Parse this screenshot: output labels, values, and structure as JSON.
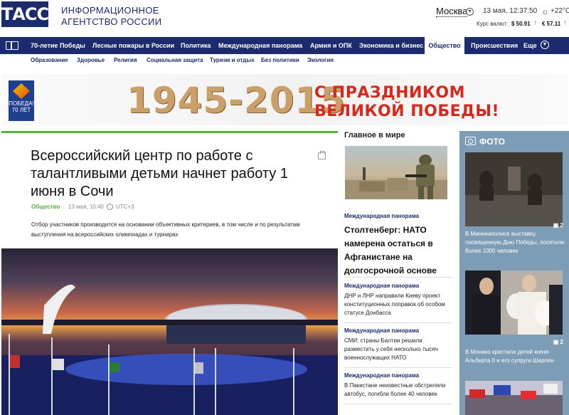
{
  "header": {
    "logo": "ТАСС",
    "agency_line1": "ИНФОРМАЦИОННОЕ",
    "agency_line2": "АГЕНТСТВО РОССИИ",
    "city": "Москва",
    "datetime": "13 мая, 12:37:50",
    "temperature": "+22°C",
    "rates_label": "Курс валют:",
    "usd": "$ 50.91",
    "eur": "€ 57.11"
  },
  "nav": {
    "items": [
      "70-летие Победы",
      "Лесные пожары в России",
      "Политика",
      "Международная панорама",
      "Армия и ОПК",
      "Экономика и бизнес",
      "Общество",
      "Происшествия",
      "Еще"
    ],
    "active": "Общество"
  },
  "subnav": [
    "Образование",
    "Здоровье",
    "Религия",
    "Социальная защита",
    "Туризм и отдых",
    "Без политики",
    "Экология"
  ],
  "banner": {
    "badge_line1": "ПОБЕДА!",
    "badge_line2": "70 ЛЕТ",
    "years": "1945-2015",
    "line1": "С ПРАЗДНИКОМ",
    "line2": "ВЕЛИКОЙ ПОБЕДЫ!"
  },
  "article": {
    "title": "Всероссийский центр по работе с талантливыми детьми начнет работу 1 июня в Сочи",
    "category": "Общество",
    "date": "13 мая, 10:40",
    "timezone": "UTC+3",
    "lead": "Отбор участников производится на основании объективных критериев, в том числе и по результатам выступления на всероссийских олимпиадах и турнирах"
  },
  "world": {
    "title": "Главное в мире",
    "main_tag": "Международная панорама",
    "main_headline": "Столтенберг: НАТО намерена остаться в Афганистане на долгосрочной основе",
    "items": [
      {
        "tag": "Международная панорама",
        "text": "ДНР и ЛНР направили Киеву проект конституционных поправок об особом статусе Донбасса"
      },
      {
        "tag": "Международная панорама",
        "text": "СМИ: страны Балтии решили разместить у себя несколько тысяч военнослужащих НАТО"
      },
      {
        "tag": "Международная панорама",
        "text": "В Пакистане неизвестные обстреляли автобус, погибли более 40 человек"
      }
    ]
  },
  "photo": {
    "title": "ФОТО",
    "items": [
      {
        "count": "2",
        "caption": "В Миннеаполисе выставку, посвященную Дню Победы, посетили более 1000 человек"
      },
      {
        "count": "2",
        "caption": "В Монако крестили детей князя Альберта II и его супруги Шарлен"
      },
      {
        "count": "",
        "caption": ""
      }
    ]
  },
  "colors": {
    "brand": "#1c2b6e",
    "accent_green": "#5ab239",
    "banner_red": "#d8281b",
    "photo_bg": "#7d9db6"
  }
}
